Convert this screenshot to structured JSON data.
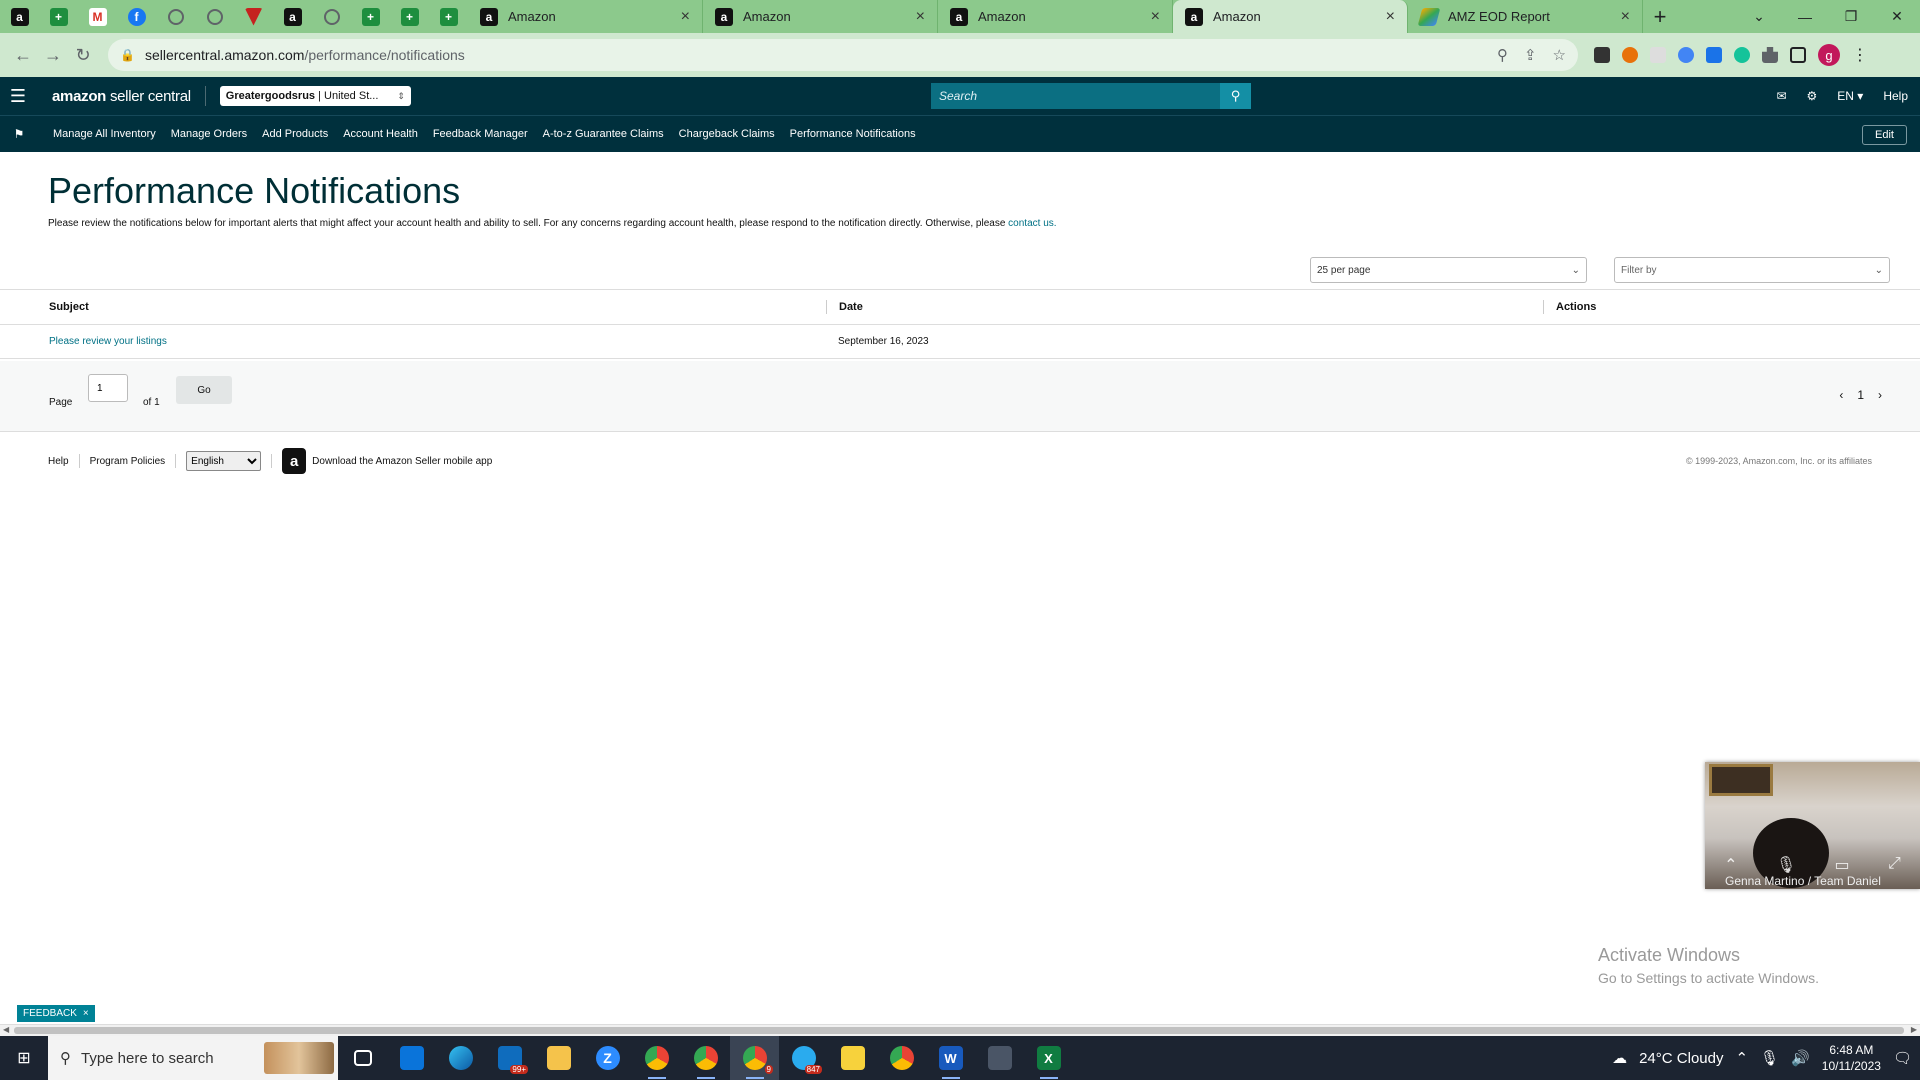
{
  "browser": {
    "pinned_tabs": [
      {
        "icon": "amazon-icon"
      },
      {
        "icon": "sheets-icon"
      },
      {
        "icon": "gmail-icon"
      },
      {
        "icon": "facebook-icon"
      },
      {
        "icon": "globe-icon"
      },
      {
        "icon": "globe-icon"
      },
      {
        "icon": "red-shield-icon"
      },
      {
        "icon": "amazon-icon"
      },
      {
        "icon": "globe-icon"
      },
      {
        "icon": "sheets-icon"
      },
      {
        "icon": "sheets-icon"
      },
      {
        "icon": "sheets-icon"
      }
    ],
    "tabs": [
      {
        "label": "Amazon",
        "active": false
      },
      {
        "label": "Amazon",
        "active": false
      },
      {
        "label": "Amazon",
        "active": false
      },
      {
        "label": "Amazon",
        "active": true
      },
      {
        "label": "AMZ EOD Report",
        "active": false
      }
    ],
    "url_host": "sellercentral.amazon.com",
    "url_path": "/performance/notifications",
    "profile_initial": "g"
  },
  "header": {
    "logo_brand": "amazon",
    "logo_product": "seller central",
    "account_name": "Greatergoodsrus",
    "account_region": "| United St...",
    "search_placeholder": "Search",
    "language": "EN",
    "help": "Help"
  },
  "nav": {
    "links": [
      "Manage All Inventory",
      "Manage Orders",
      "Add Products",
      "Account Health",
      "Feedback Manager",
      "A-to-z Guarantee Claims",
      "Chargeback Claims",
      "Performance Notifications"
    ],
    "edit": "Edit"
  },
  "page": {
    "title": "Performance Notifications",
    "description": "Please review the notifications below for important alerts that might affect your account health and ability to sell. For any concerns regarding account health, please respond to the notification directly. Otherwise, please",
    "contact_link": "contact us.",
    "per_page": "25 per page",
    "filter_placeholder": "Filter by"
  },
  "table": {
    "columns": [
      "Subject",
      "Date",
      "Actions"
    ],
    "rows": [
      {
        "subject": "Please review your listings",
        "date": "September 16, 2023",
        "actions": ""
      }
    ]
  },
  "pagination": {
    "page_label": "Page",
    "current": "1",
    "of_label": "of 1",
    "go": "Go",
    "page_number": "1"
  },
  "footer": {
    "help": "Help",
    "program_policies": "Program Policies",
    "language": "English",
    "app_text": "Download the Amazon Seller mobile app",
    "copyright": "© 1999-2023, Amazon.com, Inc. or its affiliates"
  },
  "video_call": {
    "participant": "Genna Martino / Team Daniel"
  },
  "watermark": {
    "line1": "Activate Windows",
    "line2": "Go to Settings to activate Windows."
  },
  "feedback": "FEEDBACK",
  "taskbar": {
    "search_placeholder": "Type here to search",
    "mail_badge": "99+",
    "chrome_badge": "9",
    "telegram_badge": "847",
    "weather": "24°C  Cloudy",
    "time": "6:48 AM",
    "date": "10/11/2023"
  },
  "colors": {
    "tab_strip": "#8cc98c",
    "seller_header": "#00303d",
    "link": "#007185",
    "search_button": "#148fa5"
  }
}
